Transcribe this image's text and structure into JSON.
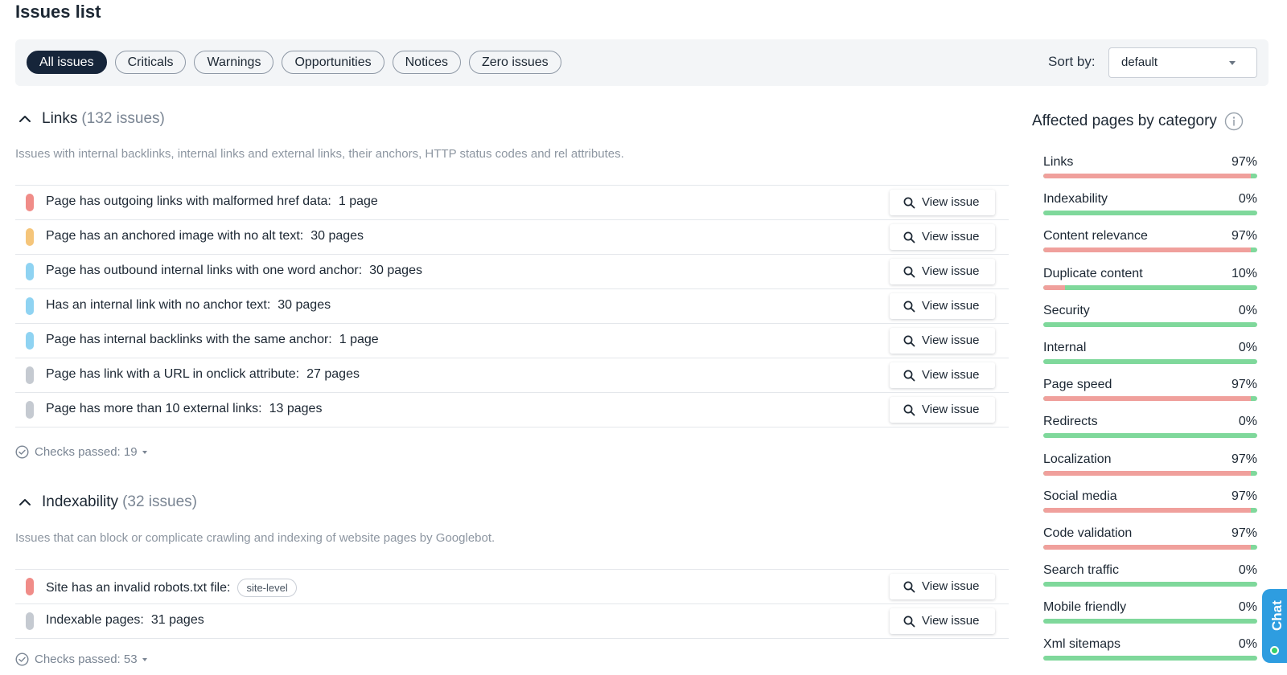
{
  "page_title": "Issues list",
  "filters": [
    {
      "label": "All issues",
      "active": true
    },
    {
      "label": "Criticals",
      "active": false
    },
    {
      "label": "Warnings",
      "active": false
    },
    {
      "label": "Opportunities",
      "active": false
    },
    {
      "label": "Notices",
      "active": false
    },
    {
      "label": "Zero issues",
      "active": false
    }
  ],
  "sort": {
    "label": "Sort by:",
    "value": "default"
  },
  "colors": {
    "critical": "#f08c88",
    "warning": "#f5c57a",
    "opportunity": "#8fd3f2",
    "notice": "#c5cad1"
  },
  "sections": [
    {
      "title": "Links",
      "count": "(132 issues)",
      "description": "Issues with internal backlinks, internal links and external links, their anchors, HTTP status codes and rel attributes.",
      "issues": [
        {
          "text": "Page has outgoing links with malformed href data:",
          "count": "1 page",
          "severity": "critical",
          "button": "View issue"
        },
        {
          "text": "Page has an anchored image with no alt text:",
          "count": "30 pages",
          "severity": "warning",
          "button": "View issue"
        },
        {
          "text": "Page has outbound internal links with one word anchor:",
          "count": "30 pages",
          "severity": "opportunity",
          "button": "View issue"
        },
        {
          "text": "Has an internal link with no anchor text:",
          "count": "30 pages",
          "severity": "opportunity",
          "button": "View issue"
        },
        {
          "text": "Page has internal backlinks with the same anchor:",
          "count": "1 page",
          "severity": "opportunity",
          "button": "View issue"
        },
        {
          "text": "Page has link with a URL in onclick attribute:",
          "count": "27 pages",
          "severity": "notice",
          "button": "View issue"
        },
        {
          "text": "Page has more than 10 external links:",
          "count": "13 pages",
          "severity": "notice",
          "button": "View issue"
        }
      ],
      "checks_passed": "Checks passed: 19"
    },
    {
      "title": "Indexability",
      "count": "(32 issues)",
      "description": "Issues that can block or complicate crawling and indexing of website pages by Googlebot.",
      "issues": [
        {
          "text": "Site has an invalid robots.txt file:",
          "tag": "site-level",
          "severity": "critical",
          "button": "View issue"
        },
        {
          "text": "Indexable pages:",
          "count": "31 pages",
          "severity": "notice",
          "button": "View issue"
        }
      ],
      "checks_passed": "Checks passed: 53"
    }
  ],
  "sidebar": {
    "title": "Affected pages by category",
    "categories": [
      {
        "label": "Links",
        "pct": "97%",
        "value": 97
      },
      {
        "label": "Indexability",
        "pct": "0%",
        "value": 0
      },
      {
        "label": "Content relevance",
        "pct": "97%",
        "value": 97
      },
      {
        "label": "Duplicate content",
        "pct": "10%",
        "value": 10
      },
      {
        "label": "Security",
        "pct": "0%",
        "value": 0
      },
      {
        "label": "Internal",
        "pct": "0%",
        "value": 0
      },
      {
        "label": "Page speed",
        "pct": "97%",
        "value": 97
      },
      {
        "label": "Redirects",
        "pct": "0%",
        "value": 0
      },
      {
        "label": "Localization",
        "pct": "97%",
        "value": 97
      },
      {
        "label": "Social media",
        "pct": "97%",
        "value": 97
      },
      {
        "label": "Code validation",
        "pct": "97%",
        "value": 97
      },
      {
        "label": "Search traffic",
        "pct": "0%",
        "value": 0
      },
      {
        "label": "Mobile friendly",
        "pct": "0%",
        "value": 0
      },
      {
        "label": "Xml sitemaps",
        "pct": "0%",
        "value": 0
      }
    ]
  },
  "chat": {
    "label": "Chat"
  }
}
